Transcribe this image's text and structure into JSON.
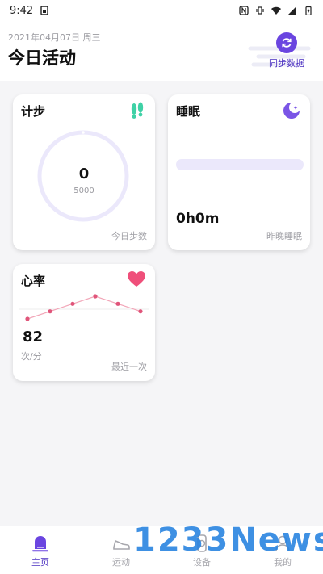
{
  "status_bar": {
    "time": "9:42"
  },
  "header": {
    "date": "2021年04月07日 周三",
    "title": "今日活动",
    "sync_label": "同步数据",
    "sync_icon": "refresh-icon"
  },
  "cards": {
    "steps": {
      "title": "计步",
      "value": "0",
      "goal": "5000",
      "footer": "今日步数",
      "icon": "footprints-icon",
      "icon_color": "#3fd1a6",
      "progress": 0
    },
    "sleep": {
      "title": "睡眠",
      "value": "0h0m",
      "footer": "昨晚睡眠",
      "icon": "moon-icon",
      "icon_color": "#7a55e6",
      "progress": 0
    },
    "heart": {
      "title": "心率",
      "value": "82",
      "unit": "次/分",
      "footer": "最近一次",
      "icon": "heart-icon",
      "icon_color": "#ef4f7a",
      "trend": [
        82,
        84,
        86,
        88,
        86,
        84
      ]
    }
  },
  "tabs": [
    {
      "label": "主页",
      "icon": "home-icon",
      "active": true
    },
    {
      "label": "运动",
      "icon": "sneaker-icon",
      "active": false
    },
    {
      "label": "设备",
      "icon": "watch-icon",
      "active": false
    },
    {
      "label": "我的",
      "icon": "user-icon",
      "active": false
    }
  ],
  "watermark": "1233News",
  "colors": {
    "accent": "#6a45e0",
    "ring": "#ebe8fb",
    "heart_line": "#f2a6b8",
    "heart_dot": "#e0557a"
  }
}
